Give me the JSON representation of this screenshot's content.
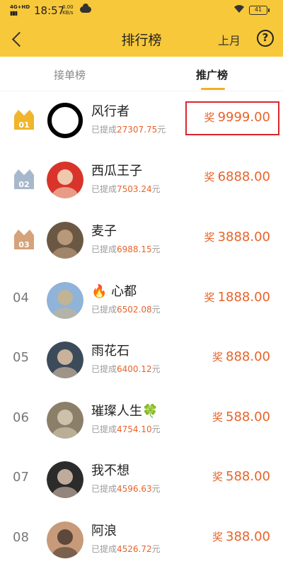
{
  "status_bar": {
    "network": "4G+HD",
    "signal_bars": "▮▮▮",
    "time": "18:57",
    "speed_value": "0.00",
    "speed_unit": "KB/s",
    "battery": "41"
  },
  "header": {
    "title": "排行榜",
    "period": "上月",
    "help_glyph": "?"
  },
  "tabs": [
    {
      "label": "接单榜"
    },
    {
      "label": "推广榜"
    }
  ],
  "colors": {
    "header_bg": "#f7c83a",
    "accent_orange": "#e8632a",
    "gold_crown": "#f0b52b",
    "silver_crown": "#a8b8cc",
    "bronze_crown": "#d6a27b",
    "highlight": "#d9262c"
  },
  "rows": [
    {
      "rank": "01",
      "name": "风行者",
      "earned_label": "已提成",
      "earned": "27307.75",
      "earned_unit": "元",
      "reward_label": "奖",
      "reward": "9999.00"
    },
    {
      "rank": "02",
      "name": "西瓜王子",
      "earned_label": "已提成",
      "earned": "7503.24",
      "earned_unit": "元",
      "reward_label": "奖",
      "reward": "6888.00"
    },
    {
      "rank": "03",
      "name": "麦子",
      "earned_label": "已提成",
      "earned": "6988.15",
      "earned_unit": "元",
      "reward_label": "奖",
      "reward": "3888.00"
    },
    {
      "rank": "04",
      "name": "🔥 心都",
      "earned_label": "已提成",
      "earned": "6502.08",
      "earned_unit": "元",
      "reward_label": "奖",
      "reward": "1888.00"
    },
    {
      "rank": "05",
      "name": "雨花石",
      "earned_label": "已提成",
      "earned": "6400.12",
      "earned_unit": "元",
      "reward_label": "奖",
      "reward": "888.00"
    },
    {
      "rank": "06",
      "name": "璀璨人生🍀",
      "earned_label": "已提成",
      "earned": "4754.10",
      "earned_unit": "元",
      "reward_label": "奖",
      "reward": "588.00"
    },
    {
      "rank": "07",
      "name": "我不想",
      "earned_label": "已提成",
      "earned": "4596.63",
      "earned_unit": "元",
      "reward_label": "奖",
      "reward": "588.00"
    },
    {
      "rank": "08",
      "name": "阿浪",
      "earned_label": "已提成",
      "earned": "4526.72",
      "earned_unit": "元",
      "reward_label": "奖",
      "reward": "388.00"
    }
  ]
}
